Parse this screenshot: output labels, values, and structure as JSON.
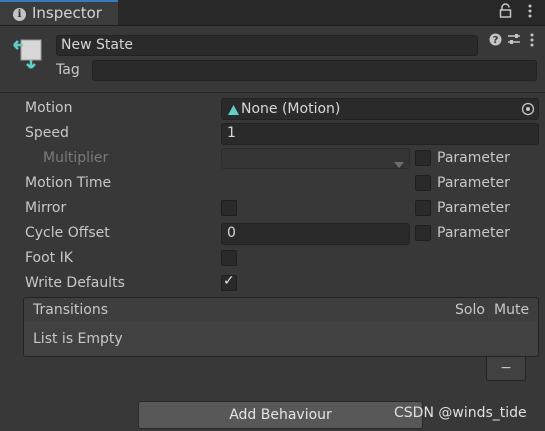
{
  "tab": {
    "title": "Inspector",
    "lock_icon": "lock-icon",
    "menu_icon": "kebab-menu-icon"
  },
  "header": {
    "name_value": "New State",
    "tag_label": "Tag",
    "tag_value": "",
    "icons": [
      "help-icon",
      "preset-icon",
      "context-menu-icon"
    ]
  },
  "properties": {
    "motion": {
      "label": "Motion",
      "value": "None (Motion)"
    },
    "speed": {
      "label": "Speed",
      "value": "1"
    },
    "multiplier": {
      "label": "Multiplier",
      "value": "",
      "param_label": "Parameter",
      "param_checked": false
    },
    "motion_time": {
      "label": "Motion Time",
      "param_label": "Parameter",
      "param_checked": false
    },
    "mirror": {
      "label": "Mirror",
      "checked": false,
      "param_label": "Parameter",
      "param_checked": false
    },
    "cycle_offset": {
      "label": "Cycle Offset",
      "value": "0",
      "param_label": "Parameter",
      "param_checked": false
    },
    "foot_ik": {
      "label": "Foot IK",
      "checked": false
    },
    "write_defaults": {
      "label": "Write Defaults",
      "checked": true
    }
  },
  "transitions": {
    "title": "Transitions",
    "col_solo": "Solo",
    "col_mute": "Mute",
    "empty_text": "List is Empty",
    "remove_label": "−"
  },
  "add_behaviour_label": "Add Behaviour",
  "watermark": "CSDN @winds_tide",
  "colors": {
    "accent": "#3a79bb",
    "background": "#383838",
    "field": "#2a2a2a",
    "motion_icon": "#5fd0c8"
  }
}
